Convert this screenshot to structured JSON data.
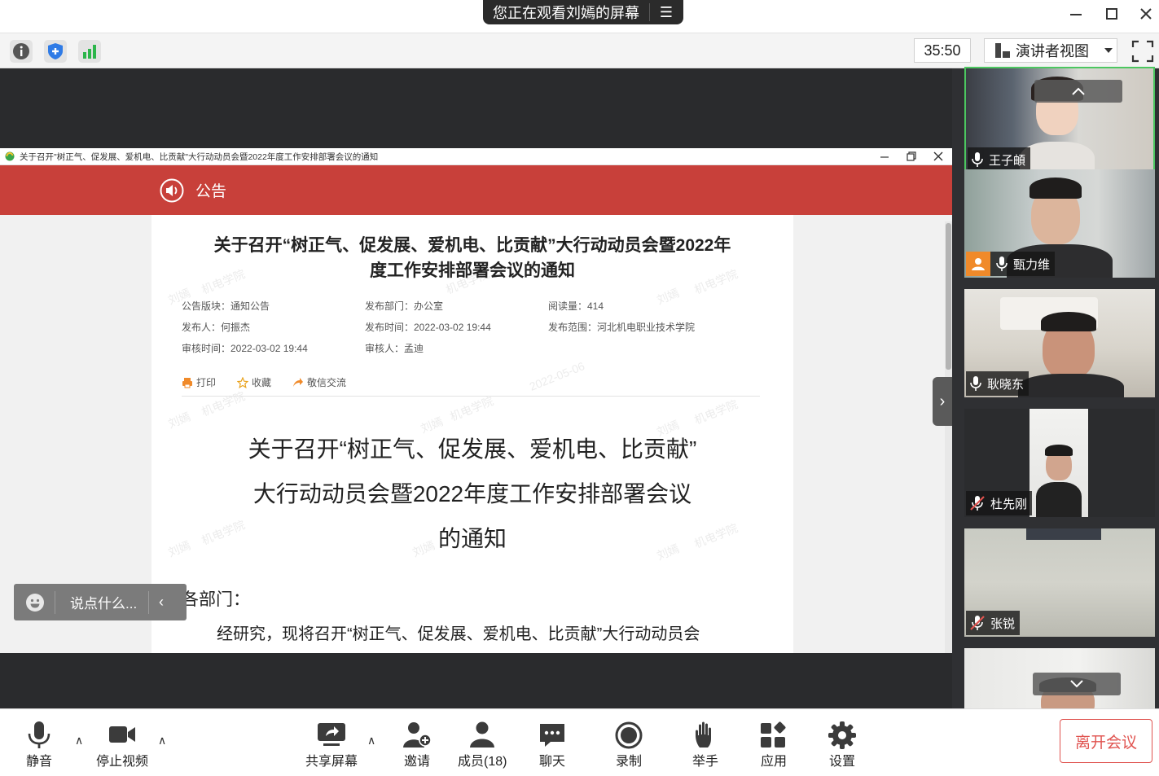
{
  "top_bar": {
    "sharing_notice": "您正在观看刘嫣的屏幕",
    "window_controls": [
      "minimize-icon",
      "maximize-icon",
      "close-icon"
    ]
  },
  "toolbar": {
    "icons": [
      "info-icon",
      "shield-icon",
      "signal-icon"
    ],
    "timer": "35:50",
    "view_mode": "演讲者视图"
  },
  "document_window": {
    "title": "关于召开\"树正气、促发展、爱机电、比贡献\"大行动动员会暨2022年度工作安排部署会议的通知",
    "header_label": "公告",
    "heading_line1": "关于召开“树正气、促发展、爱机电、比贡献”大行动动员会暨2022年",
    "heading_line2": "度工作安排部署会议的通知",
    "meta": {
      "section": "公告版块：通知公告",
      "department": "发布部门：办公室",
      "views": "阅读量：414",
      "publisher": "发布人：何振杰",
      "publish_time": "发布时间：2022-03-02 19:44",
      "scope": "发布范围：河北机电职业技术学院",
      "review_time": "审核时间：2022-03-02 19:44",
      "reviewer": "审核人：孟迪"
    },
    "actions": {
      "print": "打印",
      "favorite": "收藏",
      "exchange": "敬信交流"
    },
    "body_title_1": "关于召开“树正气、促发展、爱机电、比贡献”",
    "body_title_2": "大行动动员会暨2022年度工作安排部署会议",
    "body_title_3": "的通知",
    "salutation": "各部门：",
    "paragraph": "经研究，现将召开“树正气、促发展、爱机电、比贡献”大行动动员会",
    "watermarks": [
      "刘嫣",
      "机电学院",
      "2022-05-06"
    ]
  },
  "chat": {
    "placeholder": "说点什么..."
  },
  "participants": [
    {
      "name": "王子頔",
      "mic": "on",
      "active": true
    },
    {
      "name": "甄力维",
      "mic": "on",
      "active": false
    },
    {
      "name": "耿晓东",
      "mic": "on",
      "active": false
    },
    {
      "name": "杜先刚",
      "mic": "muted",
      "active": false
    },
    {
      "name": "张锐",
      "mic": "muted",
      "active": false
    }
  ],
  "controls": {
    "mute": "静音",
    "stop_video": "停止视频",
    "share_screen": "共享屏幕",
    "invite": "邀请",
    "members": "成员(18)",
    "chat": "聊天",
    "record": "录制",
    "raise_hand": "举手",
    "apps": "应用",
    "settings": "设置",
    "leave": "离开会议"
  },
  "colors": {
    "header_red": "#c8403a",
    "active_tile_border": "#4cc760",
    "leave_red": "#e0534f"
  }
}
